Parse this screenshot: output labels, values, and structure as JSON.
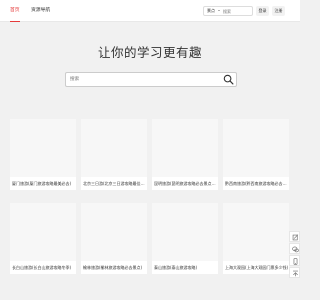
{
  "nav": {
    "items": [
      {
        "label": "首页",
        "active": true
      },
      {
        "label": "资源导航",
        "active": false
      }
    ]
  },
  "top_search": {
    "scope": "景点",
    "placeholder": "搜索"
  },
  "top_buttons": {
    "login": "登录",
    "register": "注册"
  },
  "hero": {
    "title": "让你的学习更有趣",
    "search_placeholder": "搜索"
  },
  "cards": [
    {
      "title": "厦门旅游(厦门旅游攻略最美必去)"
    },
    {
      "title": "北京三日游(北京三日游攻略最佳路线)"
    },
    {
      "title": "昆明旅游(昆明旅游攻略必去景点排名)"
    },
    {
      "title": "黔西南旅游(黔西南旅游攻略必去景点)"
    },
    {
      "title": "长白山旅游(长白山旅游攻略冬季)"
    },
    {
      "title": "榆林旅游(榆林旅游攻略必去景点)"
    },
    {
      "title": "泰山旅游(泰山旅游攻略)"
    },
    {
      "title": "上海大观园(上海大观园门票多少钱)"
    }
  ],
  "side_tools": [
    "edit-icon",
    "wechat-icon",
    "phone-icon",
    "top-icon"
  ],
  "colors": {
    "accent": "#e53b3b",
    "background": "#f1f1f1"
  }
}
